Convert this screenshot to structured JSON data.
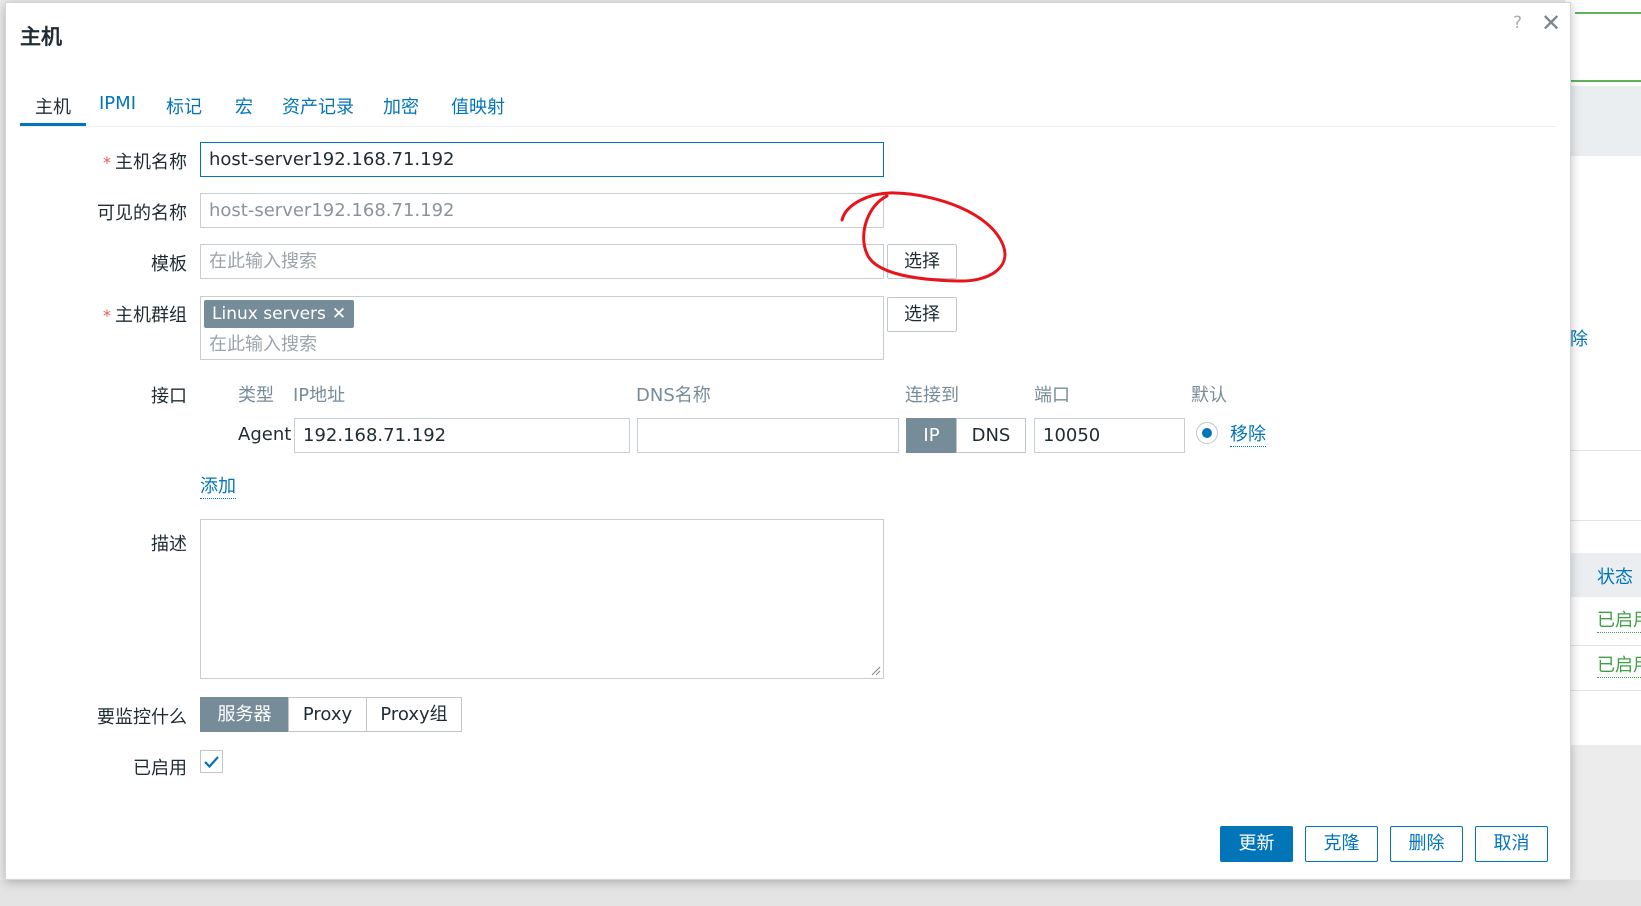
{
  "dialog": {
    "title": "主机",
    "help_icon": "?",
    "close_icon": "✕"
  },
  "tabs": [
    "主机",
    "IPMI",
    "标记",
    "宏",
    "资产记录",
    "加密",
    "值映射"
  ],
  "form": {
    "host_name_label": "主机名称",
    "host_name_value": "host-server192.168.71.192",
    "visible_name_label": "可见的名称",
    "visible_name_placeholder": "host-server192.168.71.192",
    "templates_label": "模板",
    "templates_placeholder": "在此输入搜索",
    "select_button": "选择",
    "host_groups_label": "主机群组",
    "host_group_chip": "Linux servers",
    "host_groups_placeholder": "在此输入搜索",
    "required_mark": "*"
  },
  "interfaces": {
    "label": "接口",
    "headers": {
      "type": "类型",
      "ip": "IP地址",
      "dns": "DNS名称",
      "connect_to": "连接到",
      "port": "端口",
      "default": "默认"
    },
    "rows": [
      {
        "type": "Agent",
        "ip": "192.168.71.192",
        "dns": "",
        "connect_ip": "IP",
        "connect_dns": "DNS",
        "port": "10050",
        "remove": "移除"
      }
    ],
    "add_link": "添加"
  },
  "description": {
    "label": "描述",
    "value": ""
  },
  "monitored_by": {
    "label": "要监控什么",
    "options": [
      "服务器",
      "Proxy",
      "Proxy组"
    ],
    "selected": "服务器"
  },
  "enabled": {
    "label": "已启用",
    "checked": true
  },
  "footer": {
    "update": "更新",
    "clone": "克隆",
    "delete": "删除",
    "cancel": "取消"
  },
  "background": {
    "remove_link": "移除",
    "status_header": "状态",
    "status_values": [
      "已启用",
      "已启用"
    ]
  },
  "colors": {
    "primary": "#0275b8",
    "annotation": "#e8141b",
    "chip": "#768d99",
    "enabled_green": "#429e47"
  }
}
